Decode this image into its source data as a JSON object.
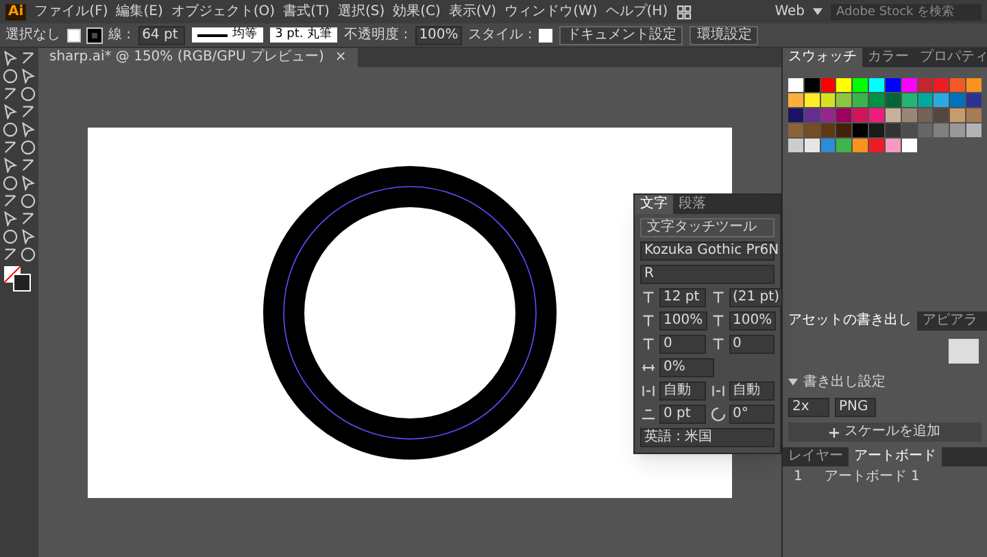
{
  "app": {
    "logo": "Ai"
  },
  "menu": [
    "ファイル(F)",
    "編集(E)",
    "オブジェクト(O)",
    "書式(T)",
    "選択(S)",
    "効果(C)",
    "表示(V)",
    "ウィンドウ(W)",
    "ヘルプ(H)"
  ],
  "top_right": {
    "workspace": "Web",
    "search_placeholder": "Adobe Stock を検索"
  },
  "control_bar": {
    "selection": "選択なし",
    "stroke_label": "線 :",
    "stroke_weight": "64 pt",
    "profile": "均等",
    "brush": "3 pt. 丸筆",
    "opacity_label": "不透明度 :",
    "opacity": "100%",
    "style_label": "スタイル :",
    "buttons": [
      "ドキュメント設定",
      "環境設定"
    ]
  },
  "document_tab": {
    "title": "sharp.ai* @ 150% (RGB/GPU プレビュー)",
    "close": "×"
  },
  "character_panel": {
    "tabs": [
      {
        "label": "文字",
        "selected": true
      },
      {
        "label": "段落",
        "selected": false
      }
    ],
    "touch_tool": "文字タッチツール",
    "font": "Kozuka Gothic Pr6N",
    "style": "R",
    "fields": [
      "12 pt",
      "(21 pt)",
      "100%",
      "100%",
      "0",
      "0"
    ],
    "tsume": "0%",
    "aki": [
      "自動",
      "自動"
    ],
    "baseline": "0 pt",
    "rotation": "0°",
    "language": "英語 : 米国"
  },
  "right_panel": {
    "top_tabs": [
      {
        "label": "スウォッチ",
        "selected": true
      },
      {
        "label": "カラー",
        "selected": false
      },
      {
        "label": "プロパティ",
        "selected": false
      }
    ],
    "swatches": [
      {
        "color": "#ffffff"
      },
      {
        "color": "#000000"
      },
      {
        "color": "#ff0000"
      },
      {
        "color": "#ffff00"
      },
      {
        "color": "#00ff00"
      },
      {
        "color": "#00ffff"
      },
      {
        "color": "#0000ff"
      },
      {
        "color": "#ff00ff"
      },
      {
        "color": "#c1272d"
      },
      {
        "color": "#ed1c24"
      },
      {
        "color": "#f15a24"
      },
      {
        "color": "#f7931e"
      },
      {
        "color": "#fbb03b"
      },
      {
        "color": "#fcee21"
      },
      {
        "color": "#d9e021"
      },
      {
        "color": "#8cc63f"
      },
      {
        "color": "#39b54a"
      },
      {
        "color": "#009245"
      },
      {
        "color": "#006837"
      },
      {
        "color": "#22b573"
      },
      {
        "color": "#00a99d"
      },
      {
        "color": "#29abe2"
      },
      {
        "color": "#0071bc"
      },
      {
        "color": "#2e3192"
      },
      {
        "color": "#1b1464"
      },
      {
        "color": "#662d91"
      },
      {
        "color": "#93278f"
      },
      {
        "color": "#9e005d"
      },
      {
        "color": "#d4145a"
      },
      {
        "color": "#ed1e79"
      },
      {
        "color": "#c7b299"
      },
      {
        "color": "#998675"
      },
      {
        "color": "#736357"
      },
      {
        "color": "#534741"
      },
      {
        "color": "#c69c6d"
      },
      {
        "color": "#a67c52"
      },
      {
        "color": "#8c6239"
      },
      {
        "color": "#754c24"
      },
      {
        "color": "#603813"
      },
      {
        "color": "#42210b"
      },
      {
        "color": "#000000"
      },
      {
        "color": "#1a1a1a"
      },
      {
        "color": "#333333"
      },
      {
        "color": "#4d4d4d"
      },
      {
        "color": "#666666"
      },
      {
        "color": "#808080"
      },
      {
        "color": "#999999"
      },
      {
        "color": "#b3b3b3"
      },
      {
        "color": "#cccccc"
      },
      {
        "color": "#e6e6e6"
      },
      {
        "color": "#2e8bd6"
      },
      {
        "color": "#3fb44a"
      },
      {
        "color": "#f7931e"
      },
      {
        "color": "#ed1c24"
      },
      {
        "color": "#f49ac1"
      },
      {
        "color": "#ffffff"
      }
    ],
    "mid_tabs": [
      {
        "label": "アセットの書き出し",
        "selected": true
      },
      {
        "label": "アピアラ",
        "selected": false
      }
    ],
    "export_heading": "書き出し設定",
    "scale": "2x",
    "format": "PNG",
    "add_scale": "スケールを追加",
    "layer_tabs": [
      {
        "label": "レイヤー",
        "selected": false
      },
      {
        "label": "アートボード",
        "selected": true
      }
    ],
    "artboards": [
      {
        "number": "1",
        "name": "アートボード 1"
      }
    ]
  }
}
